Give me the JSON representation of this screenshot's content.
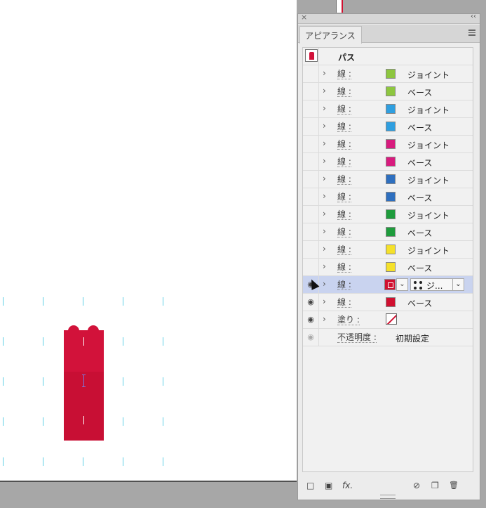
{
  "panel": {
    "title": "アピアランス",
    "close_glyph": "×",
    "collapse_glyph": "‹‹",
    "header_label": "パス",
    "rows": [
      {
        "label": "線 :",
        "color": "#8dc63f",
        "value": "ジョイント"
      },
      {
        "label": "線 :",
        "color": "#8dc63f",
        "value": "ベース"
      },
      {
        "label": "線 :",
        "color": "#2f9fe0",
        "value": "ジョイント"
      },
      {
        "label": "線 :",
        "color": "#2f9fe0",
        "value": "ベース"
      },
      {
        "label": "線 :",
        "color": "#d81b7e",
        "value": "ジョイント"
      },
      {
        "label": "線 :",
        "color": "#d81b7e",
        "value": "ベース"
      },
      {
        "label": "線 :",
        "color": "#2e6fbf",
        "value": "ジョイント"
      },
      {
        "label": "線 :",
        "color": "#2e6fbf",
        "value": "ベース"
      },
      {
        "label": "線 :",
        "color": "#1e9c3c",
        "value": "ジョイント"
      },
      {
        "label": "線 :",
        "color": "#1e9c3c",
        "value": "ベース"
      },
      {
        "label": "線 :",
        "color": "#f5e12a",
        "value": "ジョイント"
      },
      {
        "label": "線 :",
        "color": "#f5e12a",
        "value": "ベース"
      }
    ],
    "selected_row": {
      "label": "線 :",
      "color": "#d01030",
      "brush_value": "ジ..."
    },
    "red_base_row": {
      "label": "線 :",
      "color": "#d01030",
      "value": "ベース"
    },
    "fill_row": {
      "label": "塗り :"
    },
    "opacity_row": {
      "label": "不透明度 :",
      "value": "初期設定"
    },
    "chevron_glyph": "›",
    "eye_glyph": "◉",
    "dropdown_glyph": "⌄",
    "bottom_icons": {
      "new_stroke": "□",
      "new_fill": "▣",
      "fx": "fx.",
      "clear": "⊘",
      "duplicate": "❐",
      "delete": "🗑"
    }
  }
}
